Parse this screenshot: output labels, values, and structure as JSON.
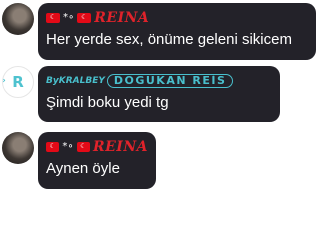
{
  "messages": [
    {
      "sender": "REINA",
      "flag_icon": "turkey-flag-icon",
      "text": "Her yerde sex, önüme geleni sikicem"
    },
    {
      "sender_prefix": "ByKRALBEY",
      "sender": "DOGUKAN REİS",
      "avatar_letter": "R",
      "avatar_tag": "»",
      "text": "Şimdi boku yedi tg"
    },
    {
      "sender": "REINA",
      "flag_icon": "turkey-flag-icon",
      "text": "Aynen öyle"
    }
  ],
  "colors": {
    "bubble_bg": "#232229",
    "reina_name": "#e0222a",
    "dogukan_name": "#49bfcc",
    "message_text": "#ffffff"
  }
}
